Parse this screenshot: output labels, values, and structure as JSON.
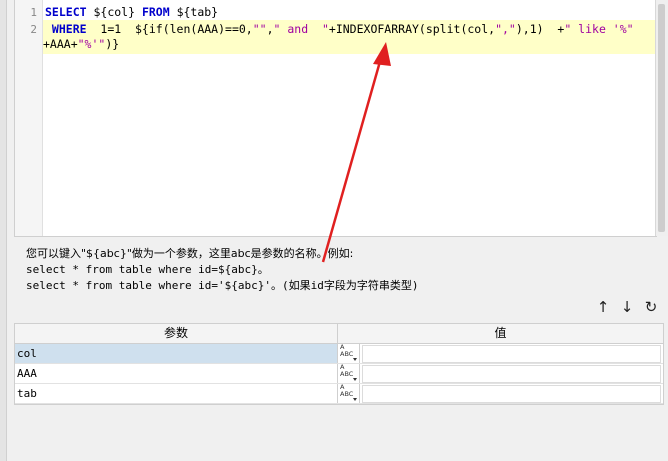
{
  "editor": {
    "line_numbers": [
      "1",
      "2"
    ],
    "line1": {
      "k_select": "SELECT",
      "t_col": " ${col} ",
      "k_from": "FROM",
      "t_tab": " ${tab}"
    },
    "line2": {
      "k_where": " WHERE",
      "t_cond": "  1=1  ${if(len(AAA)==0,",
      "s_empty": "\"\"",
      "t_comma": ",",
      "s_and": "\" and  \"",
      "t_mid": "+INDEXOFARRAY(split(col,",
      "s_comma": "\",\"",
      "t_end": "),1)  +",
      "s_like": "\" like '%\"",
      "t_cont": "+AAA+",
      "s_pct": "\"%'\"",
      "t_close": ")}"
    }
  },
  "hint": {
    "line1": "您可以键入\"${abc}\"做为一个参数，这里abc是参数的名称。例如:",
    "line2": "select * from table where id=${abc}。",
    "line3": "select * from table where id='${abc}'。(如果id字段为字符串类型)"
  },
  "toolbar": {
    "up_icon": "↑",
    "down_icon": "↓",
    "refresh_icon": "↻"
  },
  "table": {
    "headers": [
      "参数",
      "值"
    ],
    "type_icon_text": "ABC",
    "rows": [
      {
        "name": "col",
        "value": ""
      },
      {
        "name": "AAA",
        "value": ""
      },
      {
        "name": "tab",
        "value": ""
      }
    ]
  },
  "colors": {
    "keyword": "#0000cc",
    "string": "#a000a0",
    "highlight": "#ffffc8",
    "arrow": "#e02020",
    "selected_row": "#cfe0ee"
  }
}
